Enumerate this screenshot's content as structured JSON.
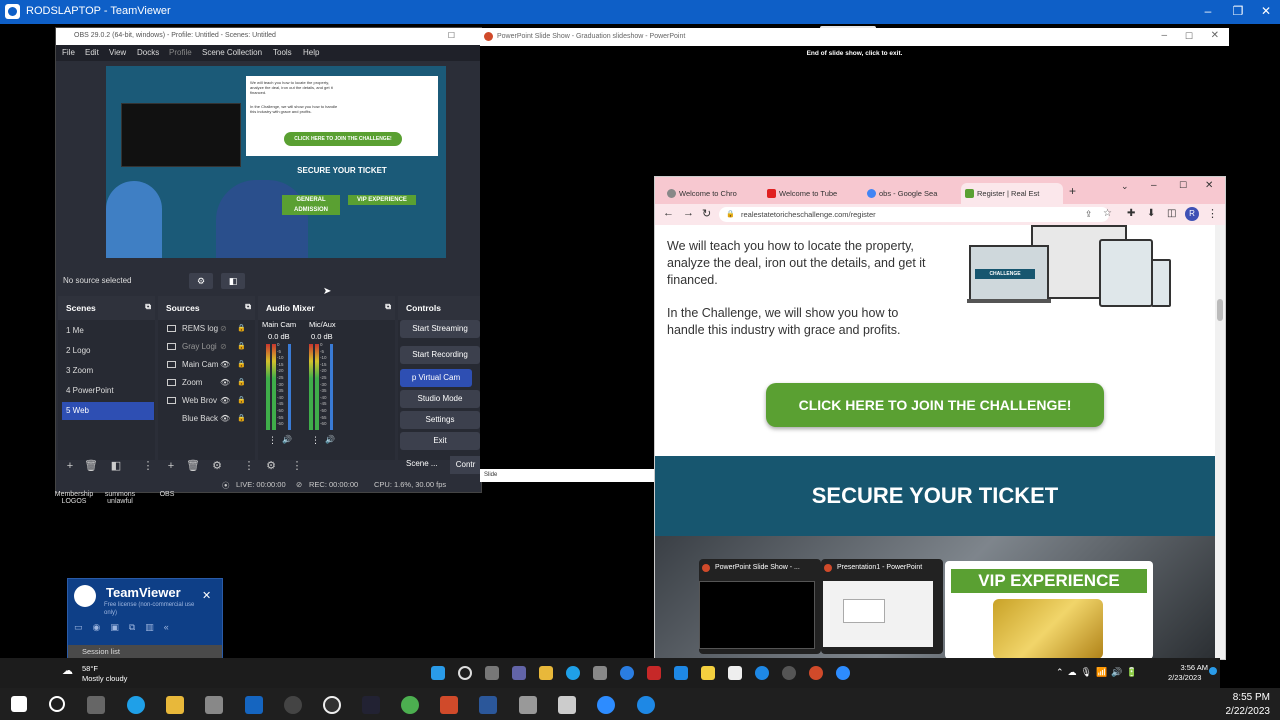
{
  "teamviewer": {
    "title": "RODSLAPTOP - TeamViewer"
  },
  "obs": {
    "title": "OBS 29.0.2 (64-bit, windows) - Profile: Untitled - Scenes: Untitled",
    "menu": [
      "File",
      "Edit",
      "View",
      "Docks",
      "Profile",
      "Scene Collection",
      "Tools",
      "Help"
    ],
    "preview": {
      "card_text1": "We will teach you how to locate the property, analyze the deal, iron out the details, and get it financed.",
      "card_text2": "In the Challenge, we will show you how to handle this industry with grace and profits.",
      "join": "CLICK HERE TO JOIN THE CHALLENGE!",
      "secure": "SECURE YOUR TICKET",
      "general": "GENERAL ADMISSION",
      "vip": "VIP EXPERIENCE"
    },
    "no_source": "No source selected",
    "docks": {
      "scenes": "Scenes",
      "sources": "Sources",
      "audio": "Audio Mixer",
      "controls": "Controls"
    },
    "scenes": [
      "1 Me",
      "2 Logo",
      "3 Zoom",
      "4 PowerPoint",
      "5 Web"
    ],
    "sources": [
      "REMS log",
      "Gray Logi",
      "Main Cam",
      "Zoom",
      "Web Brov",
      "Blue Back"
    ],
    "audio": {
      "ch1": "Main Cam",
      "ch1_db": "0.0 dB",
      "ch2": "Mic/Aux",
      "ch2_db": "0.0 dB",
      "ticks": [
        "0",
        "-5",
        "-10",
        "-15",
        "-20",
        "-25",
        "-30",
        "-35",
        "-40",
        "-45",
        "-50",
        "-55",
        "-60"
      ]
    },
    "controls": [
      "Start Streaming",
      "Start Recording",
      "p Virtual Cam",
      "Studio Mode",
      "Settings",
      "Exit"
    ],
    "tabs": {
      "scene": "Scene ...",
      "contr": "Contr"
    },
    "status": {
      "live": "LIVE: 00:00:00",
      "rec": "REC: 00:00:00",
      "cpu": "CPU: 1.6%, 30.00 fps"
    }
  },
  "desktop_icons": [
    {
      "label": "Membership LOGOS"
    },
    {
      "label": "summons unlawful"
    },
    {
      "label": "OBS"
    }
  ],
  "ppt": {
    "title": "PowerPoint Slide Show - Graduation slideshow - PowerPoint",
    "end_msg": "End of slide show, click to exit.",
    "slide_label": "Slide"
  },
  "chrome": {
    "tabs": [
      "Welcome to Chro",
      "Welcome to Tube",
      "obs - Google Sea",
      "Register | Real Est"
    ],
    "url": "realestatetoricheschallenge.com/register",
    "profile_initial": "R",
    "text1": "We will teach you how to locate the property, analyze the deal, iron out the details, and get it financed.",
    "text2": "In the Challenge, we will show you how to handle this industry with grace and profits.",
    "join_button": "CLICK HERE TO JOIN THE CHALLENGE!",
    "secure": "SECURE YOUR TICKET",
    "thumb1": "PowerPoint Slide Show - ...",
    "thumb2": "Presentation1 - PowerPoint",
    "vip": "VIP EXPERIENCE",
    "hero_label": "CHALLENGE"
  },
  "tv_panel": {
    "brand": "TeamViewer",
    "license": "Free license (non-commercial use only)",
    "session": "Session list"
  },
  "remote_taskbar": {
    "weather_temp": "58°F",
    "weather_desc": "Mostly cloudy",
    "time": "3:56 AM",
    "date": "2/23/2023"
  },
  "local_taskbar": {
    "time": "8:55 PM",
    "date": "2/22/2023"
  },
  "colors": {
    "tv_blue": "#0e5fc7",
    "obs_bg": "#2b2e38",
    "obs_accent": "#2e4fb3",
    "green": "#5aa032",
    "teal": "#17566f",
    "chrome_tab": "#f7c8d0"
  }
}
